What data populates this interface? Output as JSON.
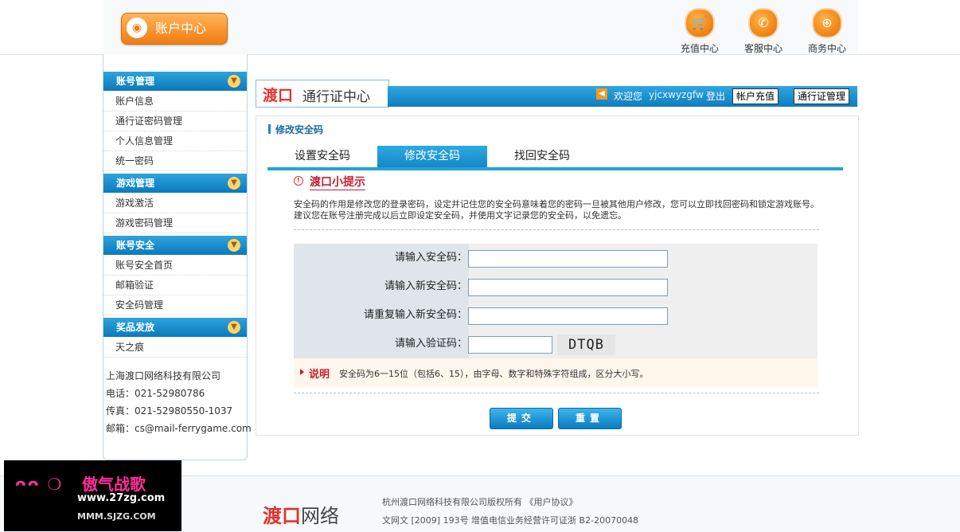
{
  "header": {
    "account_center": "账户中心",
    "nav": [
      {
        "label": "充值中心",
        "icon": "cart-icon"
      },
      {
        "label": "客服中心",
        "icon": "phone-icon"
      },
      {
        "label": "商务中心",
        "icon": "globe-icon"
      }
    ]
  },
  "sidebar": {
    "groups": [
      {
        "title": "账号管理",
        "items": [
          "账户信息",
          "通行证密码管理",
          "个人信息管理",
          "统一密码"
        ]
      },
      {
        "title": "游戏管理",
        "items": [
          "游戏激活",
          "游戏密码管理"
        ]
      },
      {
        "title": "账号安全",
        "items": [
          "账号安全首页",
          "邮箱验证",
          "安全码管理"
        ]
      },
      {
        "title": "奖品发放",
        "items": [
          "天之痕"
        ]
      }
    ],
    "company": {
      "name": "上海渡口网络科技有限公司",
      "phone": "电话：021-52980786",
      "fax": "传真：021-52980550-1037",
      "email": "邮箱：cs@mail-ferrygame.com"
    }
  },
  "portal": {
    "logo_brand": "渡口",
    "logo_text": "通行证中心",
    "welcome": "欢迎您",
    "username": "yjcxwyzgfw",
    "logout": "登出",
    "recharge_btn": "帐户充值",
    "passport_btn": "通行证管理"
  },
  "main": {
    "breadcrumb": "修改安全码",
    "tabs": [
      "设置安全码",
      "修改安全码",
      "找回安全码"
    ],
    "active_tab": 1,
    "tip_title": "渡口小提示",
    "tip_text": "安全码的作用是修改您的登录密码，设定并记住您的安全码意味着您的密码一旦被其他用户修改，您可以立即找回密码和锁定游戏账号。建议您在账号注册完成以后立即设定安全码，并使用文字记录您的安全码，以免遗忘。",
    "form": {
      "current_label": "请输入安全码：",
      "current_value": "",
      "new_label": "请输入新安全码：",
      "new_value": "",
      "repeat_label": "请重复输入新安全码：",
      "repeat_value": "",
      "captcha_label": "请输入验证码：",
      "captcha_value": "",
      "captcha_image": "DTQB"
    },
    "note_title": "说明",
    "note_text": "安全码为6一15位（包括6、15），由字母、数字和特殊字符组成，区分大小写。",
    "submit": "提交",
    "reset": "重置"
  },
  "footer": {
    "logo_brand": "渡口",
    "logo_text": "网络",
    "copyright": "杭州渡口网络科技有限公司版权所有  《用户协议》",
    "license": "文网文 [2009] 193号  增值电信业务经营许可证浙  B2-20070048"
  },
  "watermark": {
    "face": "ᴖᴖ ❍",
    "title": "傲气战歌",
    "site": "www.27zg.com",
    "site_mirror": "MMM.SJZG.COM"
  }
}
